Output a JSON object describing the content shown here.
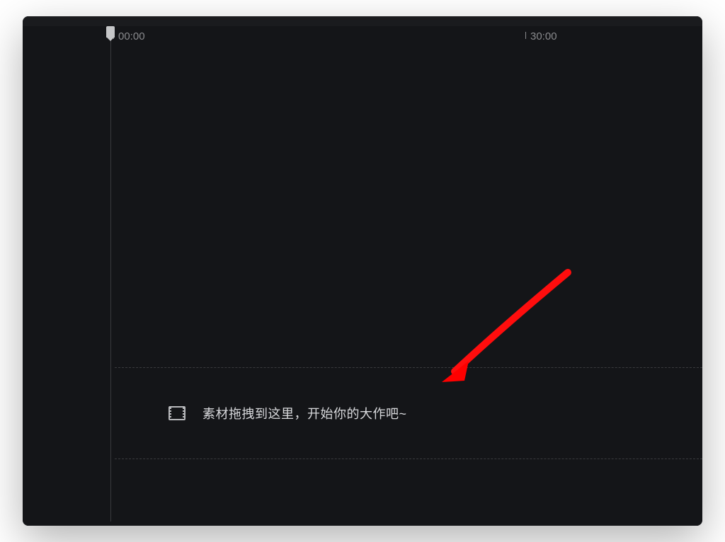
{
  "timeline": {
    "markers": [
      {
        "label": "00:00"
      },
      {
        "label": "30:00"
      }
    ]
  },
  "dropzone": {
    "hint_text": "素材拖拽到这里，开始你的大作吧~"
  }
}
